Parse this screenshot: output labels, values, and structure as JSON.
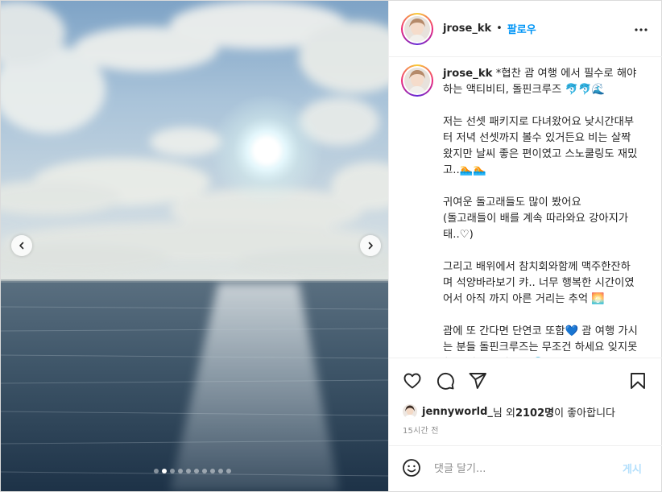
{
  "post": {
    "username": "jrose_kk",
    "separator": "•",
    "follow_label": "팔로우",
    "caption": {
      "username": "jrose_kk",
      "text": " *협찬 괌 여행 에서 필수로 해야하는 액티비티, 돌핀크루즈 🐬🐬🌊\n\n저는 선셋 패키지로 다녀왔어요 낮시간대부터 저녁 선셋까지 볼수 있거든요 비는 살짝왔지만 날씨 좋은 편이였고 스노쿨링도 재밌고..🏊🏊\n\n귀여운 돌고래들도 많이 봤어요\n(돌고래들이 배를 계속 따라와요 강아지가태..♡)\n\n그리고 배위에서 참치회와함께 맥주한잔하며 석양바라보기 캬.. 너무 행복한 시간이였어서 아직 까지 아른 거리는 추억 🌅\n\n괌에 또 간다면 단연코 또함💙 괌 여행 가시는 분들 돌핀크루즈는 무조건 하세요 잊지못할 추억이 될거에요 🐬"
    },
    "likes": {
      "user": "jennyworld_",
      "middle": "님 외 ",
      "count": "2102명",
      "suffix": "이 좋아합니다"
    },
    "time": "15시간 전",
    "comment_placeholder": "댓글 달기...",
    "post_label": "게시"
  },
  "carousel": {
    "total": 10,
    "active_index": 1
  },
  "colors": {
    "accent": "#0095f6",
    "post_disabled": "#b2dffc",
    "muted": "#8e8e8e"
  },
  "icons": {
    "more": "more-horizontal-icon",
    "like": "heart-icon",
    "comment": "comment-icon",
    "share": "paper-plane-icon",
    "save": "bookmark-icon",
    "emoji": "smiley-icon",
    "prev": "chevron-left-icon",
    "next": "chevron-right-icon"
  }
}
